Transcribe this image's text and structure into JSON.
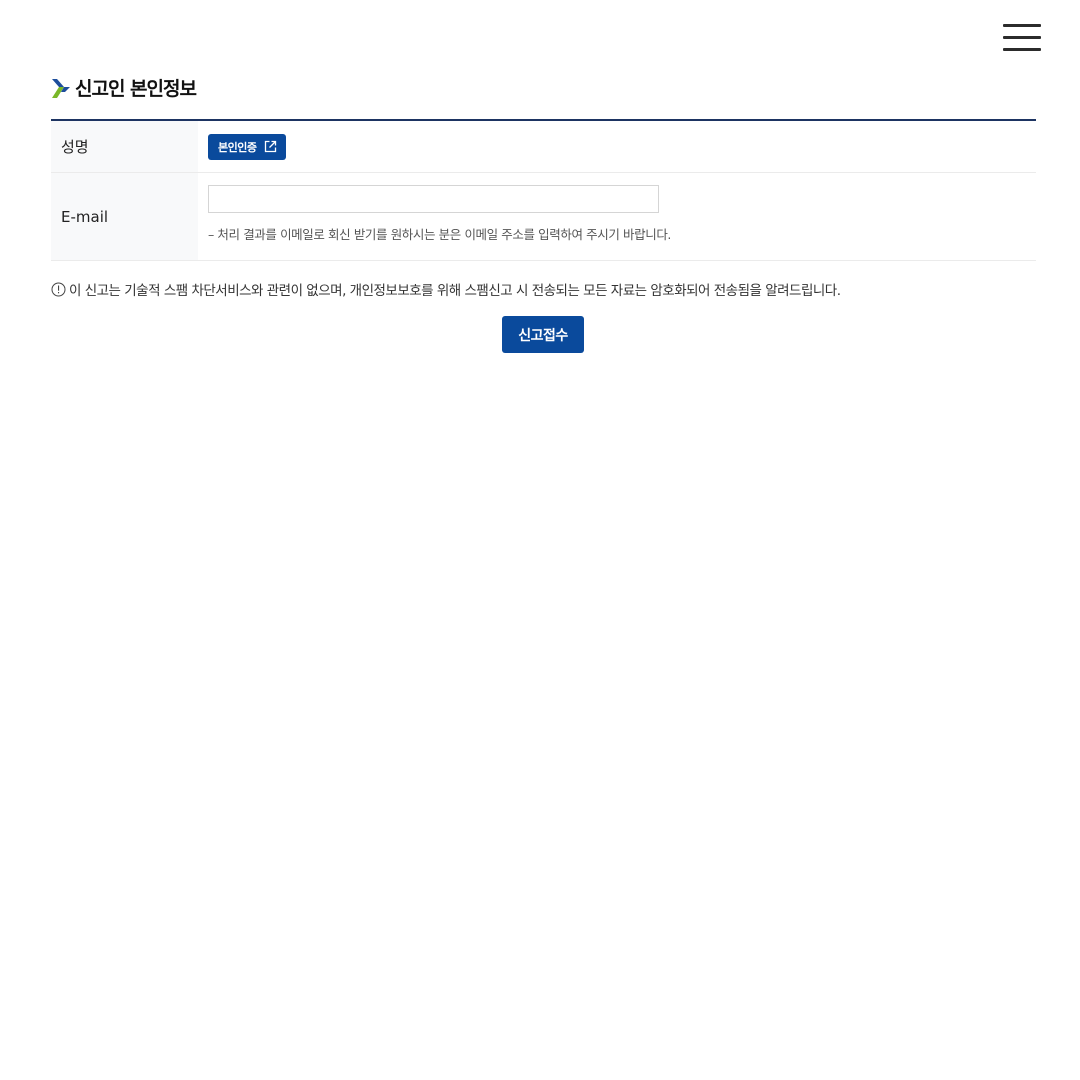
{
  "header": {
    "menu_icon": "hamburger-menu-icon"
  },
  "section": {
    "title": "신고인 본인정보",
    "title_icon": "chevron-mark-icon",
    "colors": {
      "chevron_blue": "#1d4e9c",
      "chevron_green": "#7ab829"
    }
  },
  "form": {
    "name_label": "성명",
    "verify_button_label": "본인인증",
    "verify_button_icon": "external-link-icon",
    "email_label": "E-mail",
    "email_value": "",
    "email_placeholder": "",
    "email_help": "–  처리 결과를 이메일로 회신 받기를 원하시는 분은 이메일 주소를 입력하여 주시기 바랍니다."
  },
  "notice": {
    "icon": "info-circle-icon",
    "text": "이 신고는 기술적 스팸 차단서비스와 관련이 없으며, 개인정보보호를 위해 스팸신고 시 전송되는 모든 자료는 암호화되어 전송됨을 알려드립니다."
  },
  "actions": {
    "submit_label": "신고접수"
  },
  "colors": {
    "primary": "#0a4a9c",
    "table_border_top": "#1d3462",
    "header_cell_bg": "#f8f9fa"
  }
}
